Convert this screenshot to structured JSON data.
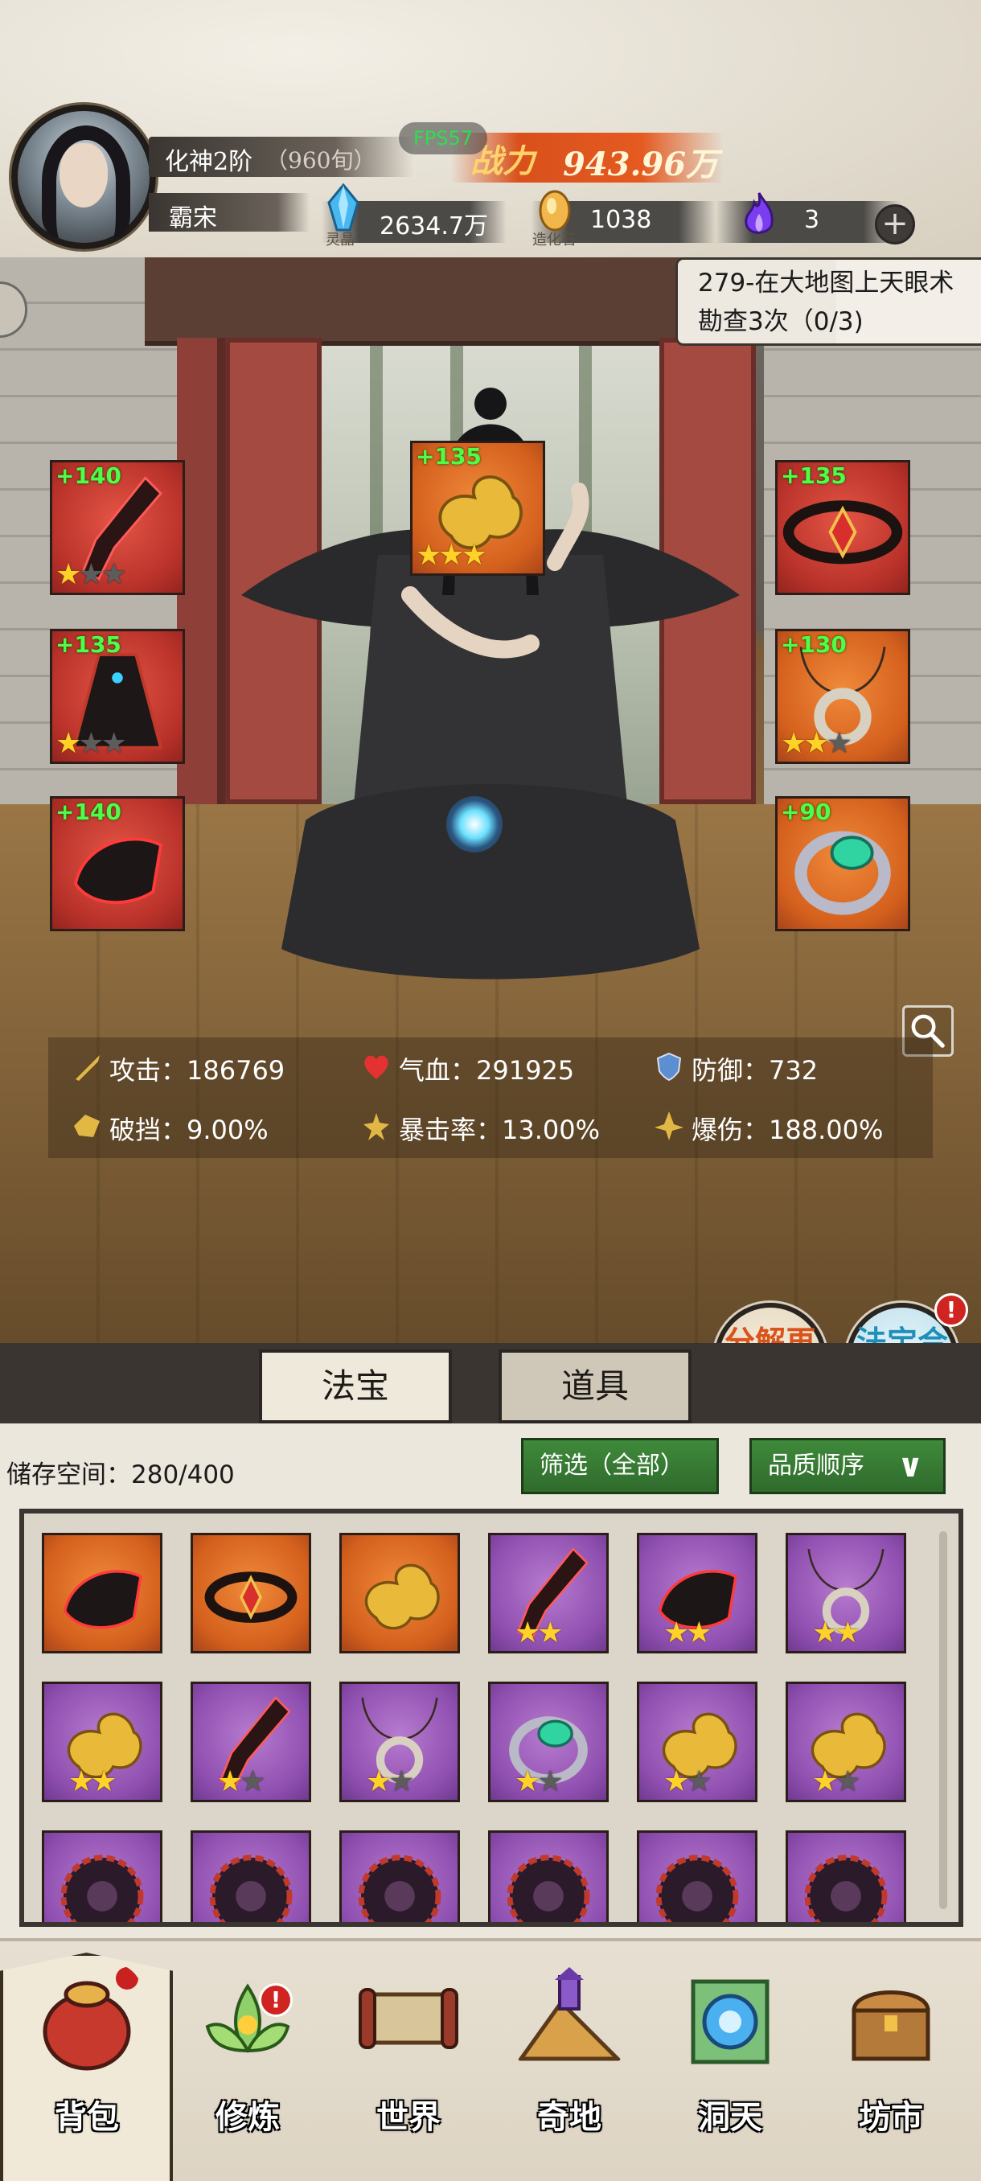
{
  "player": {
    "rank": "化神2阶",
    "rank_sub": "（960旬）",
    "name": "霸宋",
    "power_label": "战力",
    "power_value": "943.96万",
    "fps": "FPS57"
  },
  "resources": [
    {
      "icon": "spirit-crystal-icon",
      "value": "2634.7万",
      "caption": "灵晶"
    },
    {
      "icon": "creation-stone-icon",
      "value": "1038",
      "caption": "造化石"
    },
    {
      "icon": "purple-flame-icon",
      "value": "3",
      "caption": ""
    }
  ],
  "quest": {
    "text": "279-在大地图上天眼术勘查3次（0/3)"
  },
  "equipment": [
    {
      "slot": "weapon",
      "bonus": "+140",
      "stars": 1,
      "max": 3,
      "rarity": "red"
    },
    {
      "slot": "treasure",
      "bonus": "+135",
      "stars": 3,
      "max": 3,
      "rarity": "orange"
    },
    {
      "slot": "crown",
      "bonus": "+135",
      "stars": 0,
      "max": 0,
      "rarity": "red"
    },
    {
      "slot": "robe",
      "bonus": "+135",
      "stars": 1,
      "max": 3,
      "rarity": "red"
    },
    {
      "slot": "necklace",
      "bonus": "+130",
      "stars": 2,
      "max": 3,
      "rarity": "orange"
    },
    {
      "slot": "boots",
      "bonus": "+140",
      "stars": 0,
      "max": 0,
      "rarity": "red"
    },
    {
      "slot": "ring",
      "bonus": "+90",
      "stars": 0,
      "max": 0,
      "rarity": "orange"
    }
  ],
  "stats": {
    "attack": "攻击：186769",
    "hp": "气血：291925",
    "defense": "防御：732",
    "break": "破挡：9.00%",
    "crit_rate": "暴击率：13.00%",
    "crit_dmg": "爆伤：188.00%"
  },
  "actions": {
    "decompose": "分解再造",
    "synthesize": "法宝合成",
    "badge": "!"
  },
  "tabs": [
    {
      "label": "法宝",
      "active": true
    },
    {
      "label": "道具",
      "active": false
    }
  ],
  "inventory": {
    "storage": "储存空间：280/400",
    "filter": "筛选（全部）",
    "sort": "品质顺序",
    "items": [
      {
        "type": "boots",
        "rarity": "orange",
        "stars": 0
      },
      {
        "type": "crown",
        "rarity": "orange",
        "stars": 0
      },
      {
        "type": "treasure",
        "rarity": "orange",
        "stars": 0
      },
      {
        "type": "weapon",
        "rarity": "purple",
        "stars": 2
      },
      {
        "type": "boots",
        "rarity": "purple",
        "stars": 2
      },
      {
        "type": "necklace",
        "rarity": "purple",
        "stars": 2
      },
      {
        "type": "treasure",
        "rarity": "purple",
        "stars": 2
      },
      {
        "type": "weapon",
        "rarity": "purple",
        "stars": 1
      },
      {
        "type": "necklace",
        "rarity": "purple",
        "stars": 1
      },
      {
        "type": "ring",
        "rarity": "purple",
        "stars": 1
      },
      {
        "type": "treasure",
        "rarity": "purple",
        "stars": 1
      },
      {
        "type": "treasure",
        "rarity": "purple",
        "stars": 1
      },
      {
        "type": "wheel",
        "rarity": "purple",
        "stars": 0
      },
      {
        "type": "wheel",
        "rarity": "purple",
        "stars": 0
      },
      {
        "type": "wheel",
        "rarity": "purple",
        "stars": 0
      },
      {
        "type": "wheel",
        "rarity": "purple",
        "stars": 0
      },
      {
        "type": "wheel",
        "rarity": "purple",
        "stars": 0
      },
      {
        "type": "wheel",
        "rarity": "purple",
        "stars": 0
      }
    ]
  },
  "nav": [
    {
      "label": "背包",
      "icon": "bag-icon",
      "active": true,
      "badge": ""
    },
    {
      "label": "修炼",
      "icon": "lotus-icon",
      "active": false,
      "badge": "!"
    },
    {
      "label": "世界",
      "icon": "scroll-map-icon",
      "active": false,
      "badge": ""
    },
    {
      "label": "奇地",
      "icon": "mountain-pagoda-icon",
      "active": false,
      "badge": ""
    },
    {
      "label": "洞天",
      "icon": "portal-gate-icon",
      "active": false,
      "badge": ""
    },
    {
      "label": "坊市",
      "icon": "treasure-chest-icon",
      "active": false,
      "badge": ""
    }
  ],
  "colors": {
    "red": "#b9322a",
    "orange": "#d4601d",
    "purple": "#8f4fb0",
    "power": "#e45a20",
    "bonus_green": "#4cff46",
    "star": "#ffd227"
  }
}
